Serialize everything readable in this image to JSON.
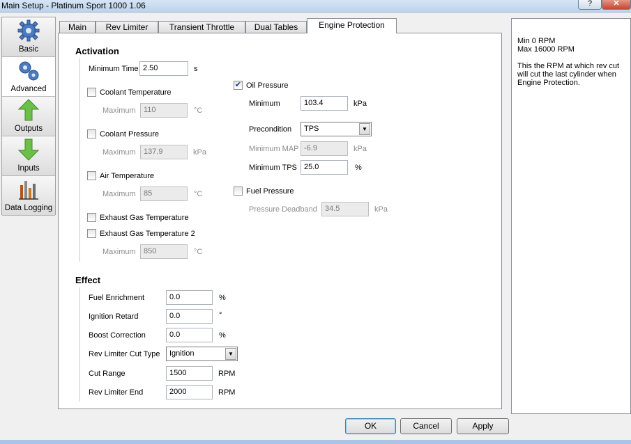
{
  "window": {
    "title": "Main Setup - Platinum Sport 1000 1.06",
    "help_label": "?",
    "close_label": "✕"
  },
  "sidebar": {
    "items": [
      {
        "label": "Basic",
        "icon": "gear-icon"
      },
      {
        "label": "Advanced",
        "icon": "gears-icon"
      },
      {
        "label": "Outputs",
        "icon": "arrow-up-icon"
      },
      {
        "label": "Inputs",
        "icon": "arrow-down-icon"
      },
      {
        "label": "Data Logging",
        "icon": "data-logging-icon"
      }
    ],
    "selected": "Advanced"
  },
  "tabs": [
    {
      "label": "Main"
    },
    {
      "label": "Rev Limiter"
    },
    {
      "label": "Transient Throttle"
    },
    {
      "label": "Dual Tables"
    },
    {
      "label": "Engine Protection"
    }
  ],
  "active_tab": "Engine Protection",
  "activation": {
    "heading": "Activation",
    "min_time": {
      "label": "Minimum Time",
      "value": "2.50",
      "unit": "s"
    },
    "coolant_temp": {
      "label": "Coolant Temperature",
      "checked": false,
      "max_label": "Maximum",
      "max_value": "110",
      "unit": "°C"
    },
    "coolant_pressure": {
      "label": "Coolant Pressure",
      "checked": false,
      "max_label": "Maximum",
      "max_value": "137.9",
      "unit": "kPa"
    },
    "air_temp": {
      "label": "Air Temperature",
      "checked": false,
      "max_label": "Maximum",
      "max_value": "85",
      "unit": "°C"
    },
    "egt": {
      "label": "Exhaust Gas Temperature",
      "checked": false
    },
    "egt2": {
      "label": "Exhaust Gas Temperature 2",
      "checked": false,
      "max_label": "Maximum",
      "max_value": "850",
      "unit": "°C"
    },
    "oil_pressure": {
      "label": "Oil Pressure",
      "checked": true,
      "min_label": "Minimum",
      "min_value": "103.4",
      "min_unit": "kPa",
      "precondition_label": "Precondition",
      "precondition_value": "TPS",
      "min_map_label": "Minimum MAP",
      "min_map_value": "-6.9",
      "min_map_unit": "kPa",
      "min_tps_label": "Minimum TPS",
      "min_tps_value": "25.0",
      "min_tps_unit": "%"
    },
    "fuel_pressure": {
      "label": "Fuel Pressure",
      "checked": false,
      "deadband_label": "Pressure Deadband",
      "deadband_value": "34.5",
      "deadband_unit": "kPa"
    }
  },
  "effect": {
    "heading": "Effect",
    "fuel_enrichment": {
      "label": "Fuel Enrichment",
      "value": "0.0",
      "unit": "%"
    },
    "ignition_retard": {
      "label": "Ignition Retard",
      "value": "0.0",
      "unit": "°"
    },
    "boost_correction": {
      "label": "Boost Correction",
      "value": "0.0",
      "unit": "%"
    },
    "cut_type": {
      "label": "Rev Limiter Cut Type",
      "value": "Ignition"
    },
    "cut_range": {
      "label": "Cut Range",
      "value": "1500",
      "unit": "RPM"
    },
    "rev_limiter_end": {
      "label": "Rev Limiter End",
      "value": "2000",
      "unit": "RPM"
    }
  },
  "info": {
    "range": "Min 0 RPM\nMax 16000 RPM",
    "description": "This the RPM at which rev cut\nwill cut the last cylinder when\nEngine Protection."
  },
  "buttons": {
    "ok": "OK",
    "cancel": "Cancel",
    "apply": "Apply"
  },
  "colors": {
    "accent": "#3c7fb1",
    "titlebar": "#c7dbf1",
    "close": "#c9452d"
  }
}
